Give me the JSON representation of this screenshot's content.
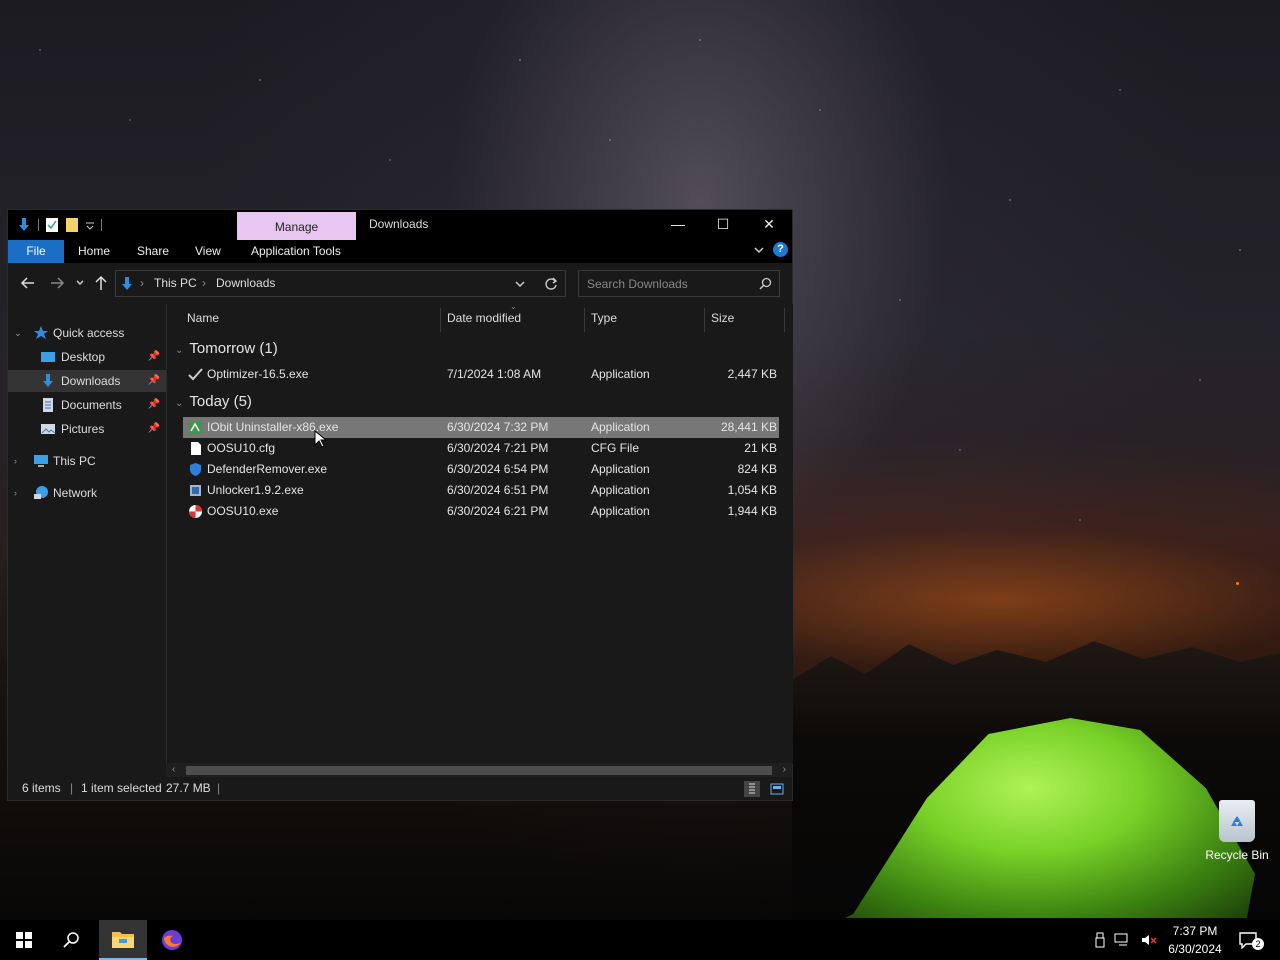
{
  "window": {
    "title": "Downloads",
    "contextual_tab": "Manage",
    "ribbon_tabs": [
      "File",
      "Home",
      "Share",
      "View",
      "Application Tools"
    ],
    "controls": {
      "minimize": "—",
      "maximize": "☐",
      "close": "✕"
    },
    "help": "?"
  },
  "address": {
    "crumbs": [
      "This PC",
      "Downloads"
    ],
    "search_placeholder": "Search Downloads"
  },
  "sidebar": {
    "items": [
      {
        "label": "Quick access",
        "icon": "star-icon"
      },
      {
        "label": "Desktop",
        "icon": "desktop-folder-icon",
        "pinned": true
      },
      {
        "label": "Downloads",
        "icon": "download-arrow-icon",
        "pinned": true,
        "selected": true
      },
      {
        "label": "Documents",
        "icon": "documents-icon",
        "pinned": true
      },
      {
        "label": "Pictures",
        "icon": "pictures-icon",
        "pinned": true
      },
      {
        "label": "This PC",
        "icon": "computer-icon"
      },
      {
        "label": "Network",
        "icon": "network-icon"
      }
    ]
  },
  "columns": [
    "Name",
    "Date modified",
    "Type",
    "Size"
  ],
  "groups": [
    {
      "label": "Tomorrow (1)",
      "files": [
        {
          "name": "Optimizer-16.5.exe",
          "date": "7/1/2024 1:08 AM",
          "type": "Application",
          "size": "2,447 KB",
          "icon": "checkmark-icon"
        }
      ]
    },
    {
      "label": "Today (5)",
      "files": [
        {
          "name": "IObit Uninstaller-x86.exe",
          "date": "6/30/2024 7:32 PM",
          "type": "Application",
          "size": "28,441 KB",
          "icon": "iobit-icon",
          "selected": true
        },
        {
          "name": "OOSU10.cfg",
          "date": "6/30/2024 7:21 PM",
          "type": "CFG File",
          "size": "21 KB",
          "icon": "blank-file-icon"
        },
        {
          "name": "DefenderRemover.exe",
          "date": "6/30/2024 6:54 PM",
          "type": "Application",
          "size": "824 KB",
          "icon": "shield-icon"
        },
        {
          "name": "Unlocker1.9.2.exe",
          "date": "6/30/2024 6:51 PM",
          "type": "Application",
          "size": "1,054 KB",
          "icon": "installer-icon"
        },
        {
          "name": "OOSU10.exe",
          "date": "6/30/2024 6:21 PM",
          "type": "Application",
          "size": "1,944 KB",
          "icon": "oosu-icon"
        }
      ]
    }
  ],
  "status": {
    "items": "6 items",
    "selected": "1 item selected",
    "size": "27.7 MB"
  },
  "desktop": {
    "recycle_bin": "Recycle Bin"
  },
  "taskbar": {
    "time": "7:37 PM",
    "date": "6/30/2024",
    "notification_count": "2"
  },
  "colors": {
    "file_tab": "#1a6fc4",
    "manage_tab": "#e7c7f2",
    "selection": "#777777"
  }
}
